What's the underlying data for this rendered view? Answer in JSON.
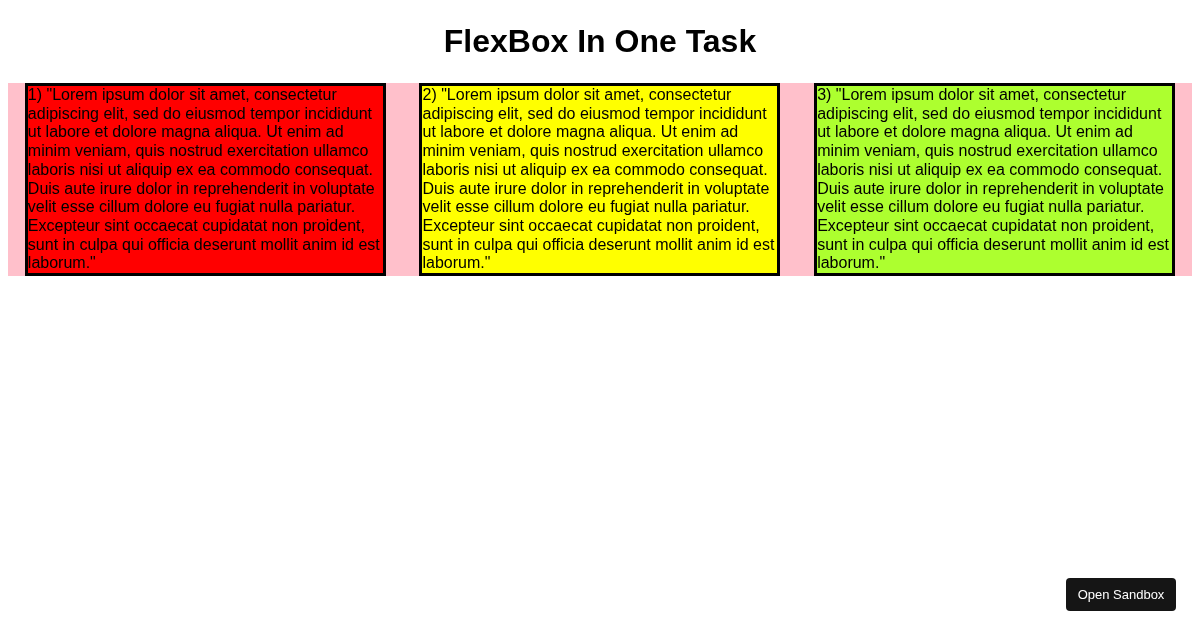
{
  "title": "FlexBox In One Task",
  "boxes": [
    {
      "text": "1) \"Lorem ipsum dolor sit amet, consectetur adipiscing elit, sed do eiusmod tempor incididunt ut labore et dolore magna aliqua. Ut enim ad minim veniam, quis nostrud exercitation ullamco laboris nisi ut aliquip ex ea commodo consequat. Duis aute irure dolor in reprehenderit in voluptate velit esse cillum dolore eu fugiat nulla pariatur. Excepteur sint occaecat cupidatat non proident, sunt in culpa qui officia deserunt mollit anim id est laborum.\"",
      "color": "#ff0000"
    },
    {
      "text": "2) \"Lorem ipsum dolor sit amet, consectetur adipiscing elit, sed do eiusmod tempor incididunt ut labore et dolore magna aliqua. Ut enim ad minim veniam, quis nostrud exercitation ullamco laboris nisi ut aliquip ex ea commodo consequat. Duis aute irure dolor in reprehenderit in voluptate velit esse cillum dolore eu fugiat nulla pariatur. Excepteur sint occaecat cupidatat non proident, sunt in culpa qui officia deserunt mollit anim id est laborum.\"",
      "color": "#ffff00"
    },
    {
      "text": "3) \"Lorem ipsum dolor sit amet, consectetur adipiscing elit, sed do eiusmod tempor incididunt ut labore et dolore magna aliqua. Ut enim ad minim veniam, quis nostrud exercitation ullamco laboris nisi ut aliquip ex ea commodo consequat. Duis aute irure dolor in reprehenderit in voluptate velit esse cillum dolore eu fugiat nulla pariatur. Excepteur sint occaecat cupidatat non proident, sunt in culpa qui officia deserunt mollit anim id est laborum.\"",
      "color": "#adff2f"
    }
  ],
  "sandbox_button": {
    "label": "Open Sandbox"
  }
}
